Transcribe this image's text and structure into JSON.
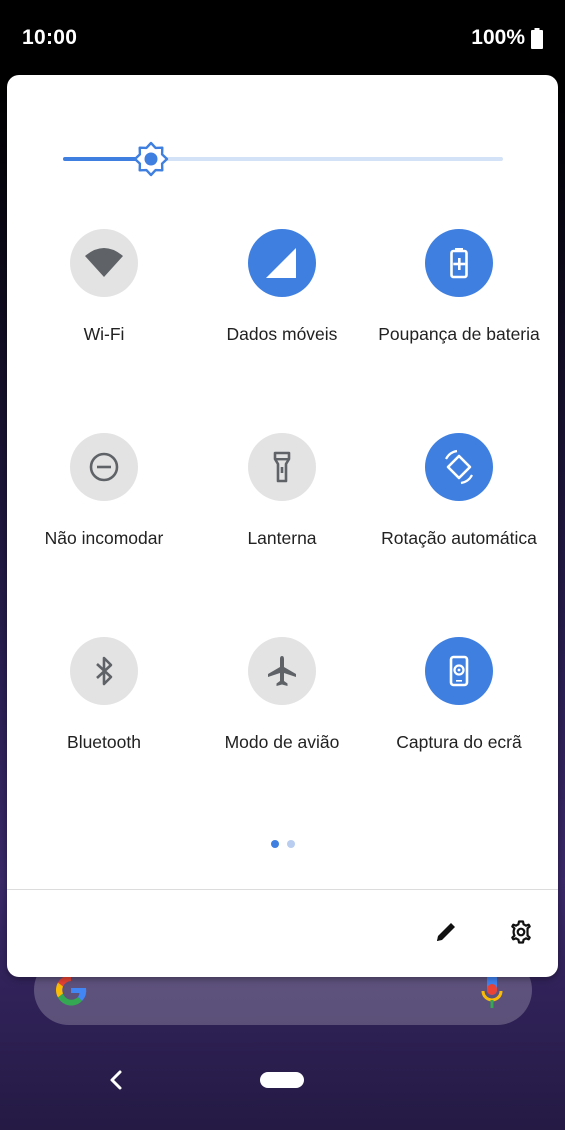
{
  "status_bar": {
    "time": "10:00",
    "battery_text": "100%"
  },
  "brightness": {
    "level_fraction": 0.2,
    "accent_color": "#3f7fe0",
    "track_color": "#d4e2f8"
  },
  "tiles": [
    {
      "label": "Wi-Fi",
      "icon": "wifi-icon",
      "active": false
    },
    {
      "label": "Dados móveis",
      "icon": "mobile-data-icon",
      "active": true
    },
    {
      "label": "Poupança de bateria",
      "icon": "battery-saver-icon",
      "active": true
    },
    {
      "label": "Não incomodar",
      "icon": "do-not-disturb-icon",
      "active": false
    },
    {
      "label": "Lanterna",
      "icon": "flashlight-icon",
      "active": false
    },
    {
      "label": "Rotação automática",
      "icon": "auto-rotate-icon",
      "active": true
    },
    {
      "label": "Bluetooth",
      "icon": "bluetooth-icon",
      "active": false
    },
    {
      "label": "Modo de avião",
      "icon": "airplane-icon",
      "active": false
    },
    {
      "label": "Captura do ecrã",
      "icon": "screen-capture-icon",
      "active": true
    }
  ],
  "pages": {
    "current": 1,
    "total": 2
  },
  "footer": {
    "edit_icon": "pencil-icon",
    "settings_icon": "gear-icon"
  },
  "colors": {
    "tile_on": "#3f7fe0",
    "tile_off": "#e3e3e3",
    "icon_off": "#5f6368"
  }
}
